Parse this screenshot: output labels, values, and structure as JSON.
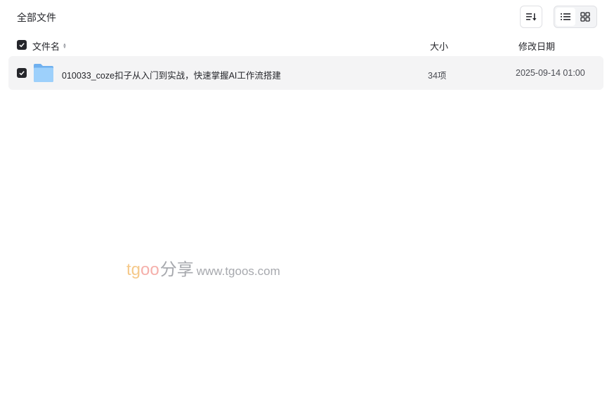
{
  "breadcrumb": {
    "title": "全部文件"
  },
  "toolbar": {
    "sort_icon": "sort-list-icon",
    "view_list_icon": "list-view-icon",
    "view_grid_icon": "grid-view-icon",
    "active_view": "list"
  },
  "columns": {
    "name": "文件名",
    "size": "大小",
    "modified": "修改日期"
  },
  "files": [
    {
      "icon": "folder-icon",
      "name": "010033_coze扣子从入门到实战，快速掌握AI工作流搭建",
      "size": "34项",
      "modified": "2025-09-14 01:00",
      "checked": true
    }
  ],
  "watermark": {
    "t": "tg",
    "oo": "oo",
    "share": "分享",
    "url": "www.tgoos.com"
  },
  "colors": {
    "folder": "#7fbcf3",
    "checkbox": "#25262b",
    "row_bg": "#f4f4f5"
  }
}
